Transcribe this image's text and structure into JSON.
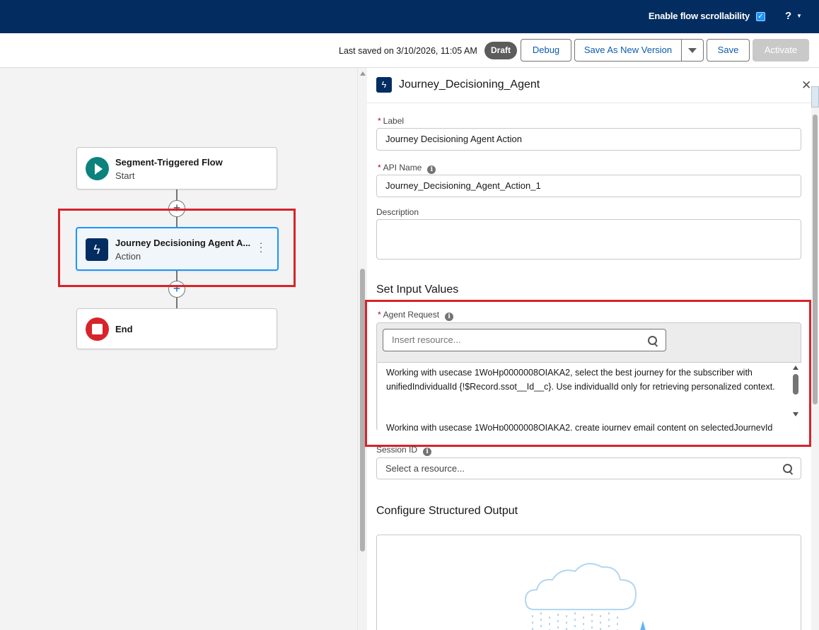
{
  "header": {
    "scroll_label": "Enable flow scrollability",
    "scroll_checked": true,
    "help": "?"
  },
  "toolbar": {
    "last_saved": "Last saved on 3/10/2026, 11:05 AM",
    "status_badge": "Draft",
    "debug": "Debug",
    "save_as_new": "Save As New Version",
    "save": "Save",
    "activate": "Activate"
  },
  "canvas": {
    "nodes": [
      {
        "title": "Segment-Triggered Flow",
        "subtitle": "Start",
        "icon": "play-icon"
      },
      {
        "title": "Journey Decisioning Agent A...",
        "subtitle": "Action",
        "icon": "lightning-icon"
      },
      {
        "title": "End",
        "subtitle": "",
        "icon": "stop-icon"
      }
    ]
  },
  "panel": {
    "title": "Journey_Decisioning_Agent",
    "label_label": "Label",
    "label_value": "Journey Decisioning Agent Action",
    "api_name_label": "API Name",
    "api_name_value": "Journey_Decisioning_Agent_Action_1",
    "description_label": "Description",
    "description_value": "",
    "set_input_title": "Set Input Values",
    "agent_request_label": "Agent Request",
    "insert_resource_placeholder": "Insert resource...",
    "agent_request_text_1": "Working with usecase 1WoHp0000008OIAKA2, select the best journey for the subscriber with unifiedIndividualId {!$Record.ssot__Id__c}. Use individualId only for retrieving personalized context.",
    "agent_request_text_2": "Working with usecase 1WoHp0000008OIAKA2, create journey email content on selectedJourneyId",
    "session_id_label": "Session ID",
    "select_resource_placeholder": "Select a resource...",
    "structured_output_title": "Configure Structured Output"
  },
  "colors": {
    "header_bg": "#032d60",
    "brand_blue": "#0b5cab",
    "highlight_red": "#d8232a",
    "start_green": "#0b827c"
  }
}
